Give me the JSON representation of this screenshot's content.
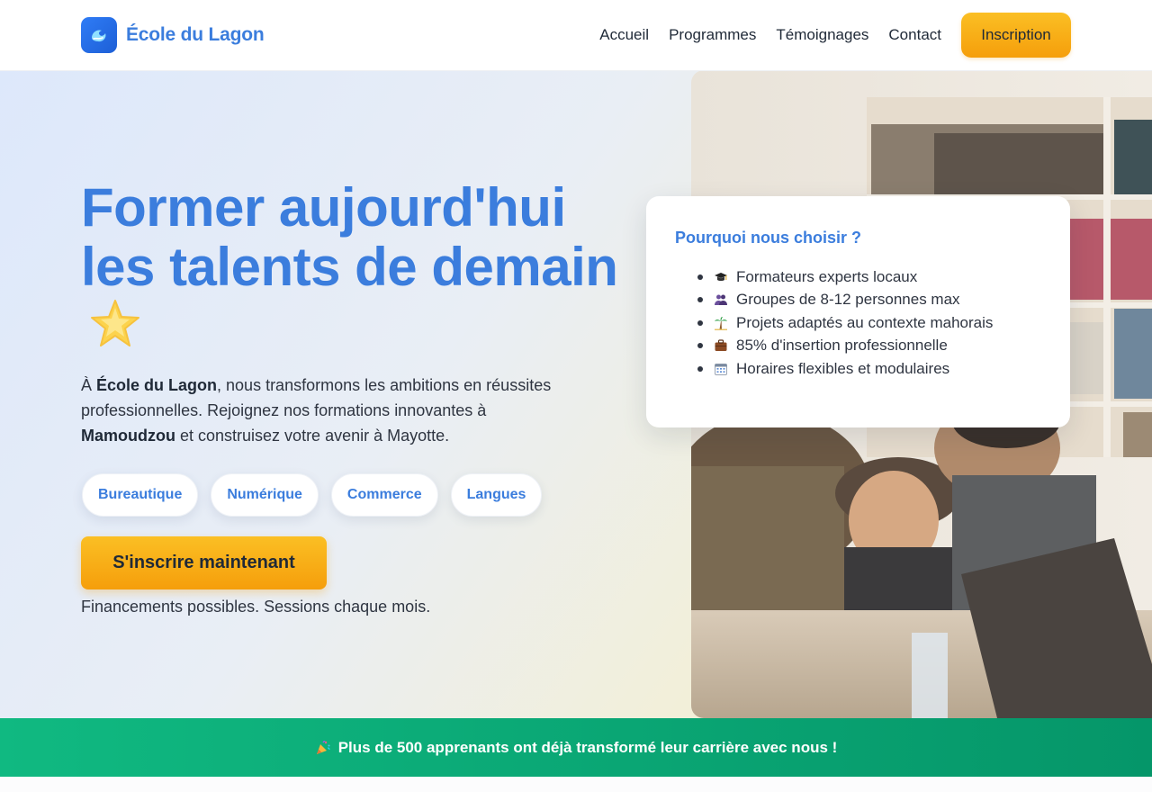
{
  "brand": {
    "name": "École du Lagon"
  },
  "nav": {
    "links": [
      "Accueil",
      "Programmes",
      "Témoignages",
      "Contact"
    ],
    "cta": "Inscription"
  },
  "hero": {
    "title_line1": "Former aujourd'hui",
    "title_line2": "les talents de demain",
    "title_icon": "star-icon",
    "intro": {
      "prefix": "À ",
      "school": "École du Lagon",
      "middle": ", nous transformons les ambitions en réussites professionnelles. Rejoignez nos formations innovantes à ",
      "city": "Mamoudzou",
      "suffix": " et construisez votre avenir à Mayotte."
    },
    "chips": [
      "Bureautique",
      "Numérique",
      "Commerce",
      "Langues"
    ],
    "cta": "S'inscrire maintenant",
    "note": "Financements possibles. Sessions chaque mois."
  },
  "card": {
    "title": "Pourquoi nous choisir ?",
    "items": [
      {
        "icon": "graduation-cap-icon",
        "text": "Formateurs experts locaux"
      },
      {
        "icon": "people-icon",
        "text": "Groupes de 8-12 personnes max"
      },
      {
        "icon": "palm-tree-icon",
        "text": "Projets adaptés au contexte mahorais"
      },
      {
        "icon": "briefcase-icon",
        "text": "85% d'insertion professionnelle"
      },
      {
        "icon": "calendar-icon",
        "text": "Horaires flexibles et modulaires"
      }
    ]
  },
  "banner": {
    "icon": "party-popper-icon",
    "text": "Plus de 500 apprenants ont déjà transformé leur carrière avec nous !"
  },
  "colors": {
    "primary": "#3b7ddd",
    "accent": "#f59e0b",
    "banner": "#10b981"
  }
}
